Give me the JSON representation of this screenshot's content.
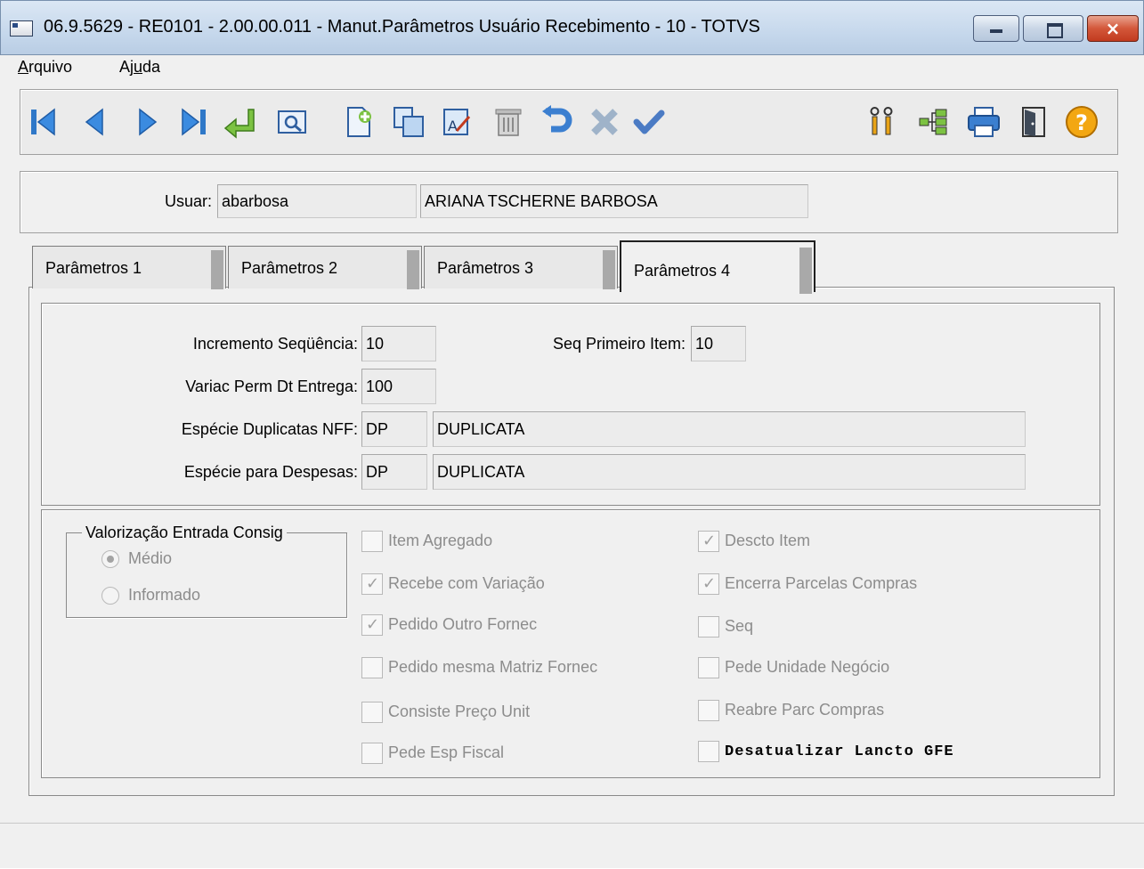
{
  "window": {
    "title": "06.9.5629 - RE0101 - 2.00.00.011 - Manut.Parâmetros Usuário Recebimento - 10 - TOTVS",
    "close_glyph": "×"
  },
  "menu": {
    "arquivo_first": "A",
    "arquivo_rest": "rquivo",
    "ajuda_first": "Aj",
    "ajuda_u": "u",
    "ajuda_rest": "da"
  },
  "toolbar": {
    "icons": [
      "first-record-icon",
      "previous-record-icon",
      "next-record-icon",
      "last-record-icon",
      "goto-icon",
      "search-icon",
      "new-record-icon",
      "copy-icon",
      "edit-icon",
      "delete-icon",
      "undo-icon",
      "cancel-icon",
      "save-icon",
      "tools-icon",
      "tree-icon",
      "print-icon",
      "exit-icon",
      "help-icon"
    ]
  },
  "user": {
    "label": "Usuar:",
    "login": "abarbosa",
    "name": "ARIANA TSCHERNE BARBOSA"
  },
  "tabs": [
    {
      "label": "Parâmetros 1"
    },
    {
      "label": "Parâmetros 2"
    },
    {
      "label": "Parâmetros 3"
    },
    {
      "label": "Parâmetros 4"
    }
  ],
  "params": {
    "incremento_label": "Incremento Seqüência:",
    "incremento_value": "10",
    "seq_primeiro_label": "Seq Primeiro Item:",
    "seq_primeiro_value": "10",
    "variac_label": "Variac Perm Dt Entrega:",
    "variac_value": "100",
    "especie_dup_label": "Espécie Duplicatas NFF:",
    "especie_dup_code": "DP",
    "especie_dup_desc": "DUPLICATA",
    "especie_desp_label": "Espécie para Despesas:",
    "especie_desp_code": "DP",
    "especie_desp_desc": "DUPLICATA"
  },
  "valorizacao": {
    "title": "Valorização Entrada Consig",
    "options": [
      {
        "label": "Médio",
        "selected": true
      },
      {
        "label": "Informado",
        "selected": false
      }
    ]
  },
  "checkboxes_left": [
    {
      "label": "Item Agregado",
      "checked": false
    },
    {
      "label": "Recebe com Variação",
      "checked": true
    },
    {
      "label": "Pedido Outro Fornec",
      "checked": true
    },
    {
      "label": "Pedido mesma Matriz Fornec",
      "checked": false
    },
    {
      "label": "Consiste Preço Unit",
      "checked": false
    },
    {
      "label": "Pede Esp Fiscal",
      "checked": false
    }
  ],
  "checkboxes_right": [
    {
      "label": "Descto Item",
      "checked": true
    },
    {
      "label": "Encerra Parcelas Compras",
      "checked": true
    },
    {
      "label": "Seq",
      "checked": false
    },
    {
      "label": "Pede Unidade Negócio",
      "checked": false
    },
    {
      "label": "Reabre Parc Compras",
      "checked": false
    },
    {
      "label": "Desatualizar Lancto GFE",
      "checked": false
    }
  ]
}
